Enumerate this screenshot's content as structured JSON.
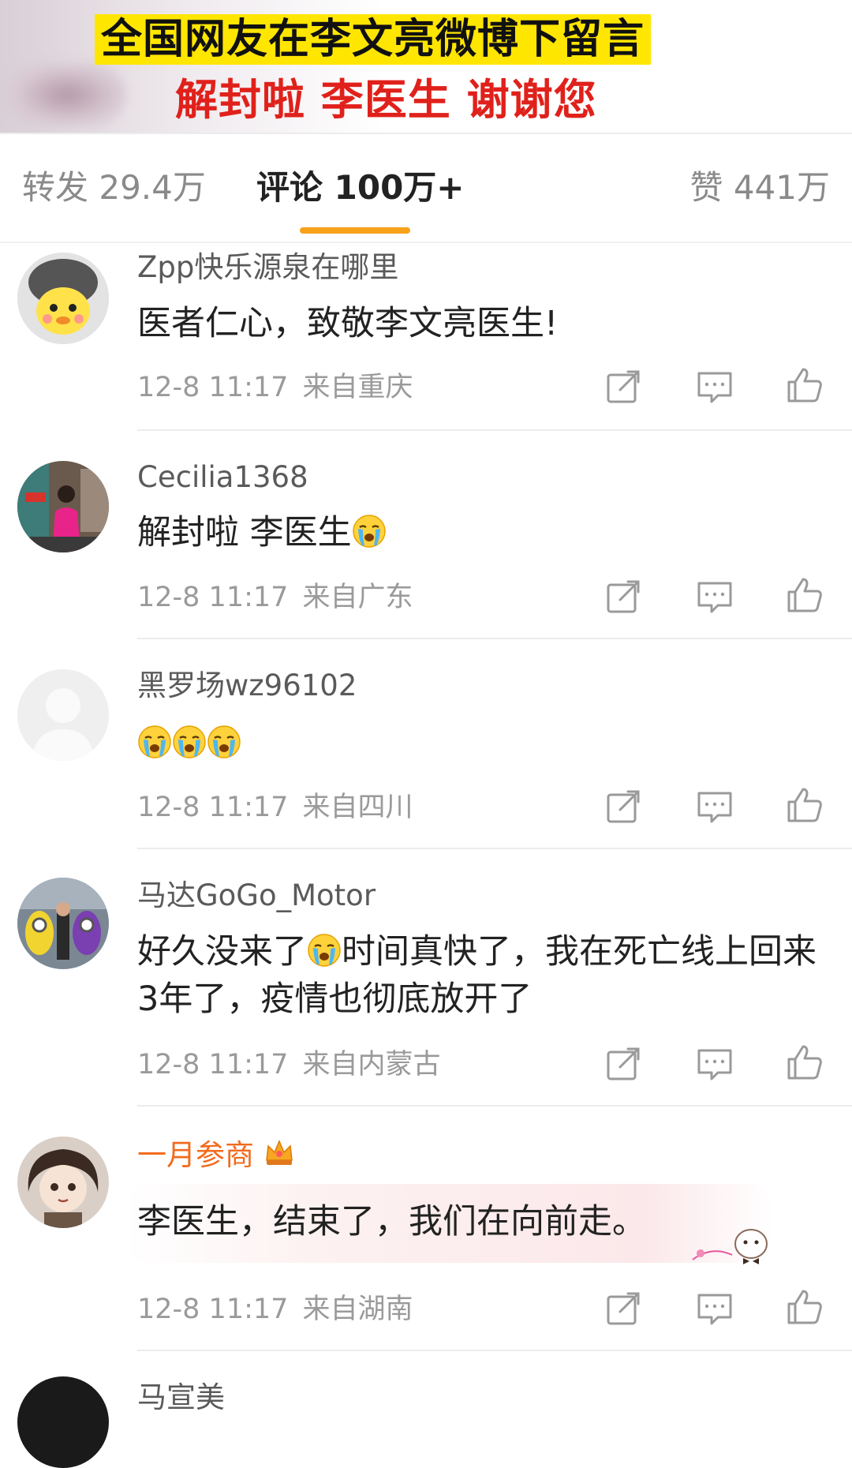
{
  "header": {
    "headline_line1": "全国网友在李文亮微博下留言",
    "headline_line2": "解封啦 李医生 谢谢您",
    "highlight_color": "#ffe600",
    "headline2_color": "#e0211b"
  },
  "tabs": [
    {
      "label": "转发 29.4万",
      "active": false
    },
    {
      "label": "评论 100万+",
      "active": true
    },
    {
      "label": "赞 441万",
      "active": false
    }
  ],
  "accent_color": "#f7a21b",
  "comments": [
    {
      "username": "Zpp快乐源泉在哪里",
      "text": "医者仁心，致敬李文亮医生!",
      "time": "12-8 11:17",
      "location": "来自重庆"
    },
    {
      "username": "Cecilia1368",
      "text": "解封啦 李医生",
      "emoji": "crying-emoji",
      "time": "12-8 11:17",
      "location": "来自广东"
    },
    {
      "username": "黑罗场wz96102",
      "text": "",
      "emoji_count": 3,
      "emoji": "crying-emoji",
      "time": "12-8 11:17",
      "location": "来自四川"
    },
    {
      "username": "马达GoGo_Motor",
      "text_before_emoji": "好久没来了",
      "text_after_emoji": "时间真快了，我在死亡线上回来3年了，疫情也彻底放开了",
      "emoji": "crying-emoji",
      "time": "12-8 11:17",
      "location": "来自内蒙古"
    },
    {
      "username": "一月参商",
      "vip": true,
      "badge": "crown-icon",
      "text": "李医生，结束了，我们在向前走。",
      "time": "12-8 11:17",
      "location": "来自湖南"
    },
    {
      "username": "马宣美"
    }
  ],
  "icons": {
    "share": "share-icon",
    "reply": "reply-icon",
    "like": "thumbs-up-icon"
  }
}
